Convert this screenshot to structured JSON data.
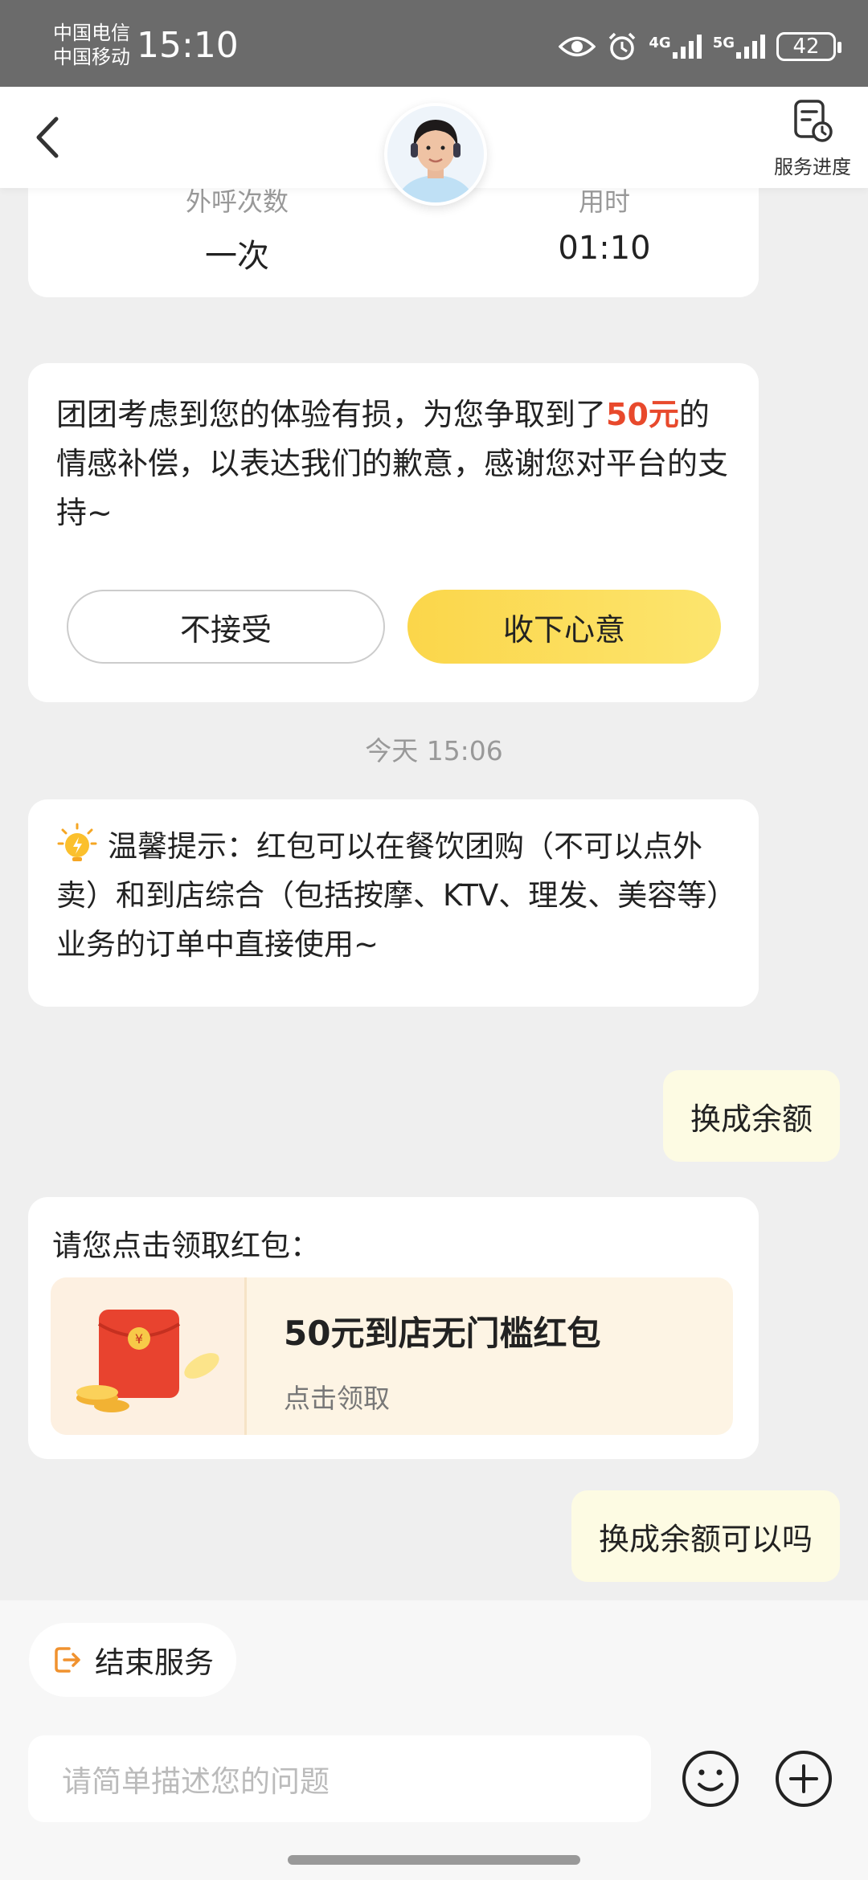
{
  "status_bar": {
    "carrier1": "中国电信",
    "carrier2": "中国移动",
    "time": "15:10",
    "net1": "4G",
    "net2": "5G",
    "battery": "42"
  },
  "header": {
    "progress_label": "服务进度"
  },
  "call_stats": {
    "count_label": "外呼次数",
    "count_value": "一次",
    "duration_label": "用时",
    "duration_value": "01:10"
  },
  "compensation": {
    "text_before": "团团考虑到您的体验有损，为您争取到了",
    "amount": "50元",
    "text_after": "的情感补偿，以表达我们的歉意，感谢您对平台的支持~",
    "reject_label": "不接受",
    "accept_label": "收下心意"
  },
  "timestamp": "今天 15:06",
  "tip": {
    "text": "温馨提示：红包可以在餐饮团购（不可以点外卖）和到店综合（包括按摩、KTV、理发、美容等）业务的订单中直接使用~"
  },
  "messages": {
    "user1": "换成余额",
    "user2": "换成余额可以吗"
  },
  "red_packet": {
    "title": "请您点击领取红包：",
    "coupon_name": "50元到店无门槛红包",
    "coupon_action": "点击领取"
  },
  "footer": {
    "end_service": "结束服务",
    "input_placeholder": "请简单描述您的问题"
  },
  "colors": {
    "accent_yellow": "#fbd64a",
    "highlight_red": "#e8492c",
    "status_bar_bg": "#6b6b6b"
  }
}
